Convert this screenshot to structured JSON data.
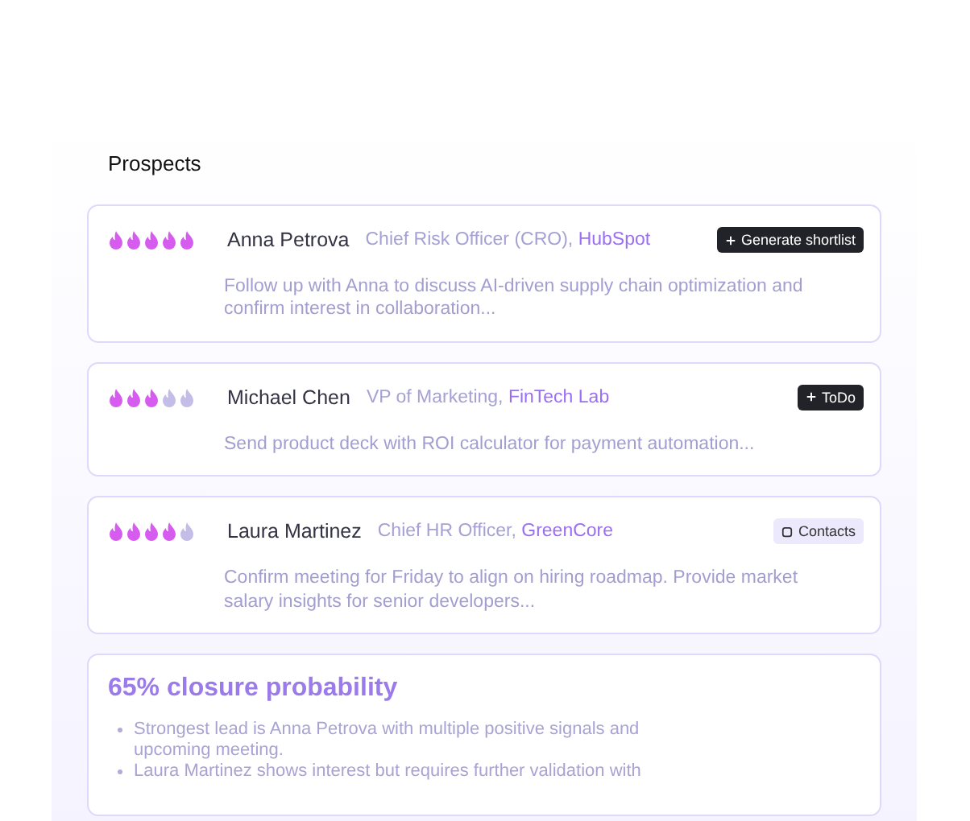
{
  "section_title": "Prospects",
  "prospects": [
    {
      "stars": 5,
      "name": "Anna Petrova",
      "role": "Chief Risk Officer (CRO), ",
      "company": "HubSpot",
      "action": {
        "kind": "dark",
        "label": "Generate shortlist"
      },
      "note": "Follow up with Anna to discuss AI-driven supply chain optimization and confirm interest in collaboration..."
    },
    {
      "stars": 3,
      "name": "Michael Chen",
      "role": "VP of Marketing, ",
      "company": "FinTech Lab",
      "action": {
        "kind": "dark",
        "label": "ToDo"
      },
      "note": "Send product deck with ROI calculator for payment automation..."
    },
    {
      "stars": 4,
      "name": "Laura Martinez",
      "role": "Chief HR Officer, ",
      "company": "GreenCore",
      "action": {
        "kind": "light",
        "label": "Contacts"
      },
      "note": "Confirm meeting for Friday to align on hiring roadmap. Provide market salary insights for senior developers..."
    }
  ],
  "summary": {
    "title": "65% closure probability",
    "points": [
      "Strongest lead is Anna Petrova with multiple positive signals and upcoming meeting.",
      "Laura Martinez shows interest but requires further validation with"
    ]
  }
}
